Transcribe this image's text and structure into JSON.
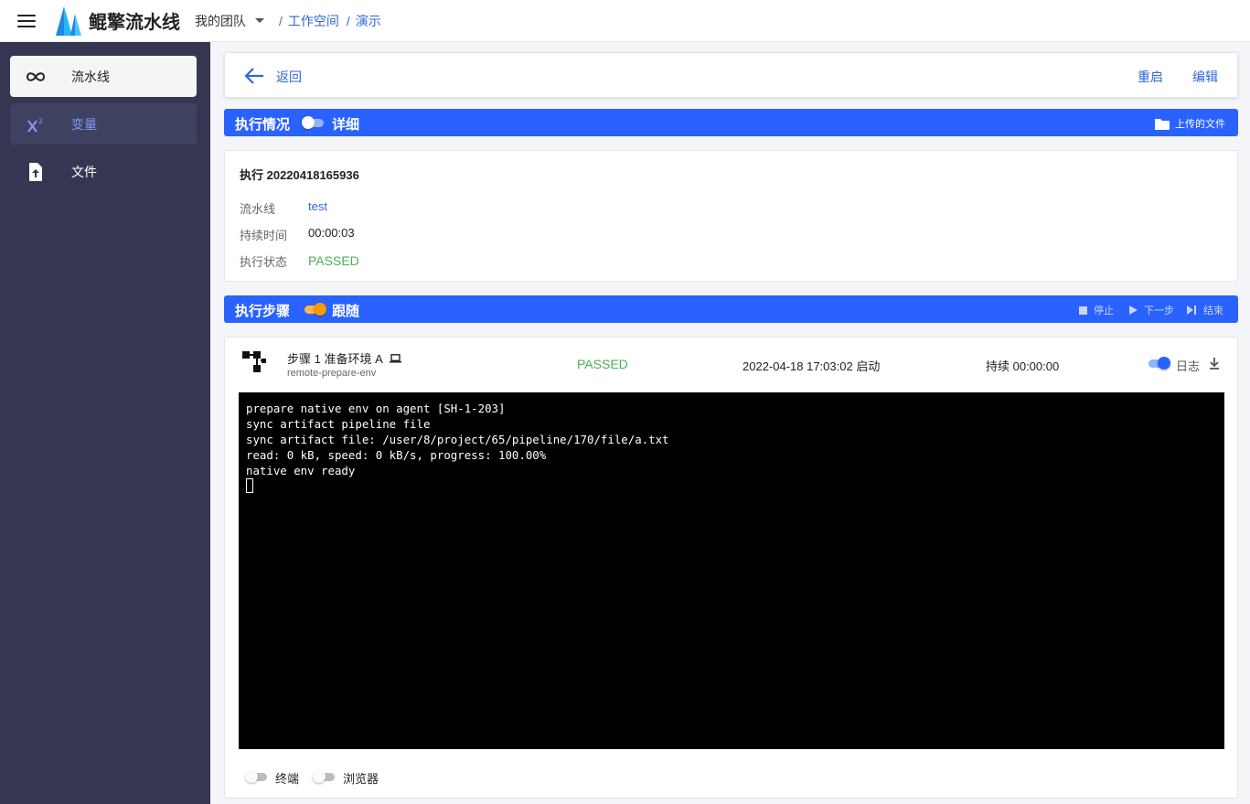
{
  "app": {
    "title": "鲲擎流水线",
    "team": "我的团队"
  },
  "breadcrumb": {
    "sep1": "/",
    "workspace": "工作空间",
    "sep2": "/",
    "project": "演示"
  },
  "sidebar": {
    "items": [
      {
        "label": "流水线",
        "icon": "infinity-icon"
      },
      {
        "label": "变量",
        "icon": "superscript-icon"
      },
      {
        "label": "文件",
        "icon": "file-upload-icon"
      }
    ]
  },
  "header": {
    "back_label": "返回",
    "restart_label": "重启",
    "edit_label": "编辑"
  },
  "execution_bar": {
    "title": "执行情况",
    "detail_label": "详细",
    "detail_on": false,
    "upload_label": "上传的文件"
  },
  "execution": {
    "title": "执行 20220418165936",
    "pipeline_label": "流水线",
    "pipeline_value": "test",
    "duration_label": "持续时间",
    "duration_value": "00:00:03",
    "status_label": "执行状态",
    "status_value": "PASSED"
  },
  "steps_bar": {
    "title": "执行步骤",
    "follow_label": "跟随",
    "follow_on": true,
    "stop_label": "停止",
    "next_label": "下一步",
    "end_label": "结束"
  },
  "step": {
    "name": "步骤 1  准备环境 A",
    "subtitle": "remote-prepare-env",
    "status": "PASSED",
    "started": "2022-04-18 17:03:02 启动",
    "duration": "持续 00:00:00",
    "log_label": "日志",
    "log_on": true
  },
  "terminal": {
    "lines": [
      "prepare native env on agent [SH-1-203]",
      "sync artifact pipeline file",
      "sync artifact file: /user/8/project/65/pipeline/170/file/a.txt",
      "read: 0 kB, speed: 0 kB/s, progress: 100.00%",
      "native env ready"
    ]
  },
  "bottom": {
    "terminal_label": "终端",
    "browser_label": "浏览器"
  },
  "colors": {
    "primary": "#2962ff",
    "link": "#2f67d6",
    "sidebar": "#353752",
    "passed": "#4caf50",
    "follow": "#ff9800"
  }
}
